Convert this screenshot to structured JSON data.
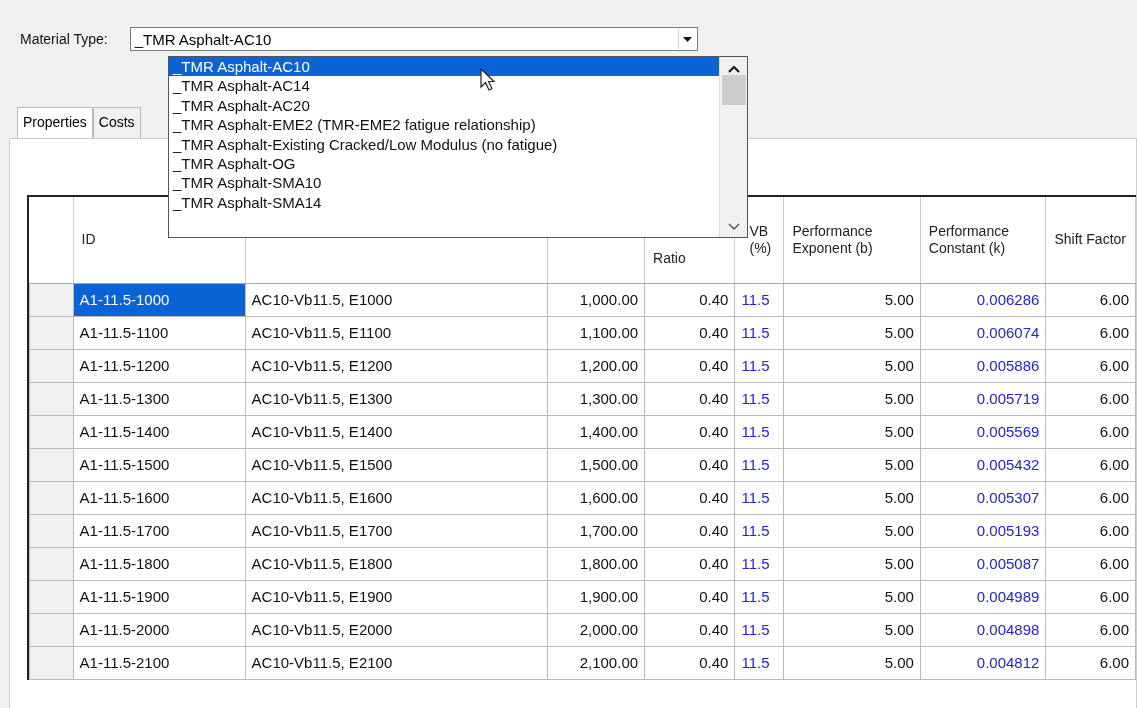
{
  "material_type": {
    "label": "Material Type:",
    "value": "_TMR Asphalt-AC10",
    "options": [
      {
        "label": "_TMR Asphalt-AC10",
        "selected": true
      },
      {
        "label": "_TMR Asphalt-AC14",
        "selected": false
      },
      {
        "label": "_TMR Asphalt-AC20",
        "selected": false
      },
      {
        "label": "_TMR Asphalt-EME2 (TMR-EME2 fatigue relationship)",
        "selected": false
      },
      {
        "label": "_TMR Asphalt-Existing Cracked/Low Modulus (no fatigue)",
        "selected": false
      },
      {
        "label": "_TMR Asphalt-OG",
        "selected": false
      },
      {
        "label": "_TMR Asphalt-SMA10",
        "selected": false
      },
      {
        "label": "_TMR Asphalt-SMA14",
        "selected": false
      }
    ]
  },
  "tabs": [
    {
      "label": "Properties",
      "selected": true
    },
    {
      "label": "Costs",
      "selected": false
    }
  ],
  "table": {
    "columns": [
      {
        "label": "ID",
        "kind": "text"
      },
      {
        "kind": "text"
      },
      {
        "kind": "number"
      },
      {
        "label": "Ratio",
        "kind": "number"
      },
      {
        "label": "VB (%)",
        "kind": "text",
        "color": "#2323d6"
      },
      {
        "label": "Performance Exponent (b)",
        "kind": "number"
      },
      {
        "label": "Performance Constant (k)",
        "kind": "number",
        "color": "#2323d6"
      },
      {
        "label": "Shift Factor",
        "kind": "number"
      }
    ],
    "rows": [
      {
        "selected": true,
        "cells": [
          "A1-11.5-1000",
          "AC10-Vb11.5, E1000",
          "1,000.00",
          "0.40",
          "11.5",
          "5.00",
          "0.006286",
          "6.00"
        ]
      },
      {
        "selected": false,
        "cells": [
          "A1-11.5-1100",
          "AC10-Vb11.5, E1100",
          "1,100.00",
          "0.40",
          "11.5",
          "5.00",
          "0.006074",
          "6.00"
        ]
      },
      {
        "selected": false,
        "cells": [
          "A1-11.5-1200",
          "AC10-Vb11.5, E1200",
          "1,200.00",
          "0.40",
          "11.5",
          "5.00",
          "0.005886",
          "6.00"
        ]
      },
      {
        "selected": false,
        "cells": [
          "A1-11.5-1300",
          "AC10-Vb11.5, E1300",
          "1,300.00",
          "0.40",
          "11.5",
          "5.00",
          "0.005719",
          "6.00"
        ]
      },
      {
        "selected": false,
        "cells": [
          "A1-11.5-1400",
          "AC10-Vb11.5, E1400",
          "1,400.00",
          "0.40",
          "11.5",
          "5.00",
          "0.005569",
          "6.00"
        ]
      },
      {
        "selected": false,
        "cells": [
          "A1-11.5-1500",
          "AC10-Vb11.5, E1500",
          "1,500.00",
          "0.40",
          "11.5",
          "5.00",
          "0.005432",
          "6.00"
        ]
      },
      {
        "selected": false,
        "cells": [
          "A1-11.5-1600",
          "AC10-Vb11.5, E1600",
          "1,600.00",
          "0.40",
          "11.5",
          "5.00",
          "0.005307",
          "6.00"
        ]
      },
      {
        "selected": false,
        "cells": [
          "A1-11.5-1700",
          "AC10-Vb11.5, E1700",
          "1,700.00",
          "0.40",
          "11.5",
          "5.00",
          "0.005193",
          "6.00"
        ]
      },
      {
        "selected": false,
        "cells": [
          "A1-11.5-1800",
          "AC10-Vb11.5, E1800",
          "1,800.00",
          "0.40",
          "11.5",
          "5.00",
          "0.005087",
          "6.00"
        ]
      },
      {
        "selected": false,
        "cells": [
          "A1-11.5-1900",
          "AC10-Vb11.5, E1900",
          "1,900.00",
          "0.40",
          "11.5",
          "5.00",
          "0.004989",
          "6.00"
        ]
      },
      {
        "selected": false,
        "cells": [
          "A1-11.5-2000",
          "AC10-Vb11.5, E2000",
          "2,000.00",
          "0.40",
          "11.5",
          "5.00",
          "0.004898",
          "6.00"
        ]
      },
      {
        "selected": false,
        "cells": [
          "A1-11.5-2100",
          "AC10-Vb11.5, E2100",
          "2,100.00",
          "0.40",
          "11.5",
          "5.00",
          "0.004812",
          "6.00"
        ]
      }
    ]
  }
}
